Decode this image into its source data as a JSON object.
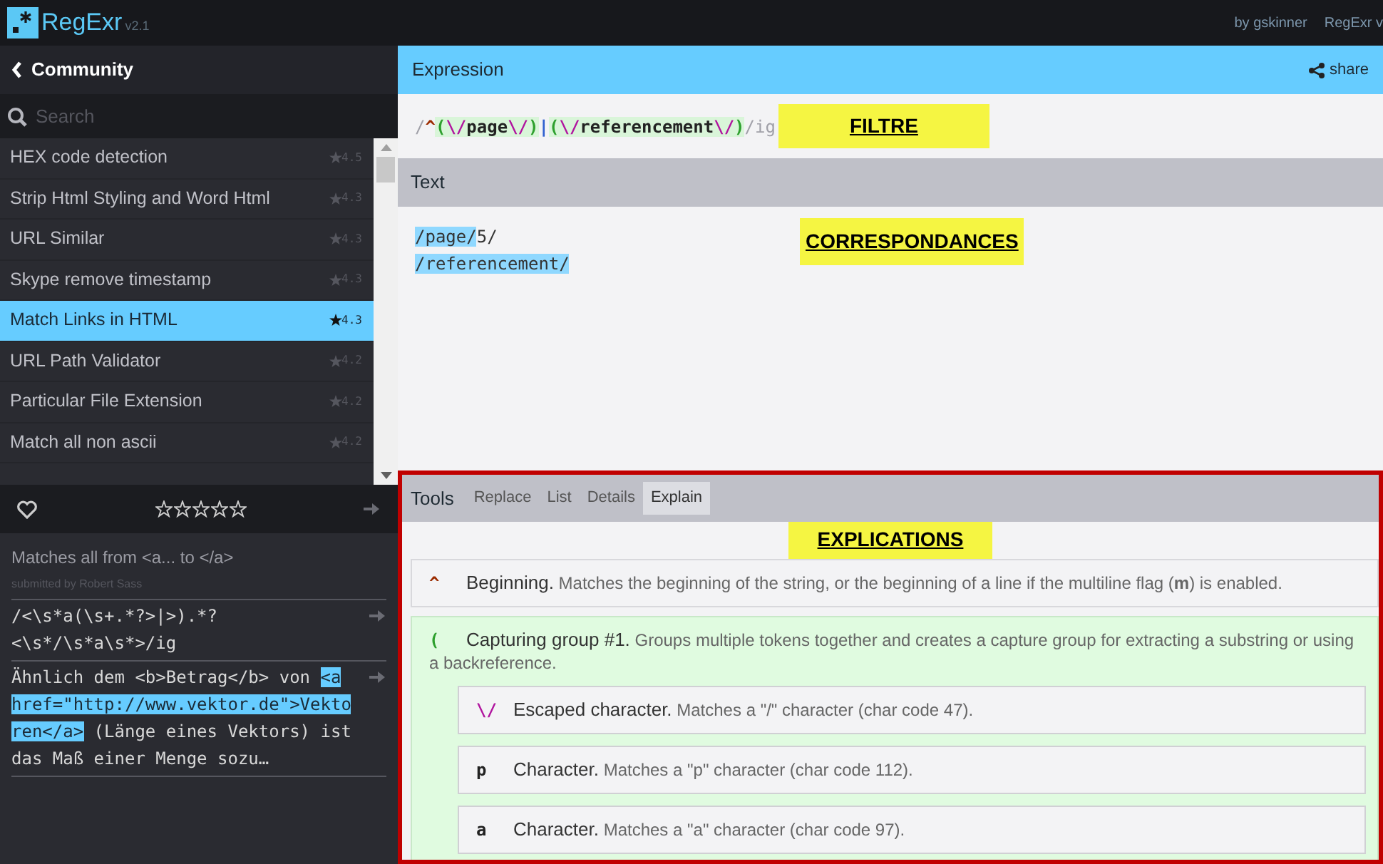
{
  "app": {
    "name": "RegExr",
    "version": "v2.1",
    "credits": [
      "by gskinner",
      "RegExr v"
    ]
  },
  "sidebar": {
    "title": "Community",
    "search": {
      "placeholder": "Search"
    },
    "items": [
      {
        "label": "HEX code detection",
        "rating": "4.5",
        "selected": false
      },
      {
        "label": "Strip Html Styling and Word Html",
        "rating": "4.3",
        "selected": false
      },
      {
        "label": "URL Similar",
        "rating": "4.3",
        "selected": false
      },
      {
        "label": "Skype remove timestamp",
        "rating": "4.3",
        "selected": false
      },
      {
        "label": "Match Links in HTML",
        "rating": "4.3",
        "selected": true
      },
      {
        "label": "URL Path Validator",
        "rating": "4.2",
        "selected": false
      },
      {
        "label": "Particular File Extension",
        "rating": "4.2",
        "selected": false
      },
      {
        "label": "Match all non ascii",
        "rating": "4.2",
        "selected": false
      }
    ],
    "details": {
      "stars": 0,
      "description": "Matches all from <a... to </a>",
      "submitted": "submitted by Robert Sass",
      "pattern": "/<\\s*a(\\s+.*?>|>).*?<\\s*/\\s*a\\s*>/ig",
      "sample": [
        {
          "text": "Ähnlich dem <b>Betrag</b> von ",
          "match": false
        },
        {
          "text": "<a href=\"http://www.vektor.de\">Vektoren</a>",
          "match": true
        },
        {
          "text": " (Länge eines Vektors) ist das Maß einer Menge sozu…",
          "match": false
        }
      ]
    }
  },
  "expression": {
    "title": "Expression",
    "share": "share",
    "tokens": [
      {
        "text": "/",
        "kind": "delimiter"
      },
      {
        "text": "^",
        "kind": "anchor"
      },
      {
        "text": "(",
        "kind": "group"
      },
      {
        "text": "\\/",
        "kind": "escape"
      },
      {
        "text": "page",
        "kind": "literal"
      },
      {
        "text": "\\/",
        "kind": "escape"
      },
      {
        "text": ")",
        "kind": "group"
      },
      {
        "text": "|",
        "kind": "alternation"
      },
      {
        "text": "(",
        "kind": "group"
      },
      {
        "text": "\\/",
        "kind": "escape"
      },
      {
        "text": "referencement",
        "kind": "literal"
      },
      {
        "text": "\\/",
        "kind": "escape"
      },
      {
        "text": ")",
        "kind": "group"
      },
      {
        "text": "/ig",
        "kind": "delimiter"
      }
    ],
    "note": "FILTRE"
  },
  "text": {
    "title": "Text",
    "note": "CORRESPONDANCES",
    "lines": [
      [
        {
          "text": "/page/",
          "match": true
        },
        {
          "text": "5/",
          "match": false
        }
      ],
      [
        {
          "text": "/referencement/",
          "match": true
        }
      ]
    ]
  },
  "tools": {
    "title": "Tools",
    "note": "EXPLICATIONS",
    "tabs": [
      {
        "label": "Replace",
        "selected": false
      },
      {
        "label": "List",
        "selected": false
      },
      {
        "label": "Details",
        "selected": false
      },
      {
        "label": "Explain",
        "selected": true
      }
    ],
    "explain": [
      {
        "token": "^",
        "kind": "anchor",
        "title": "Beginning.",
        "text": "Matches the beginning of the string, or the beginning of a line if the multiline flag (**m**) is enabled."
      },
      {
        "token": "(",
        "kind": "group",
        "title": "Capturing group #1.",
        "text": "Groups multiple tokens together and creates a capture group for extracting a substring or using a backreference.",
        "children": [
          {
            "token": "\\/",
            "kind": "escape",
            "title": "Escaped character.",
            "text": "Matches a \"/\" character (char code 47)."
          },
          {
            "token": "p",
            "kind": "literal",
            "title": "Character.",
            "text": "Matches a \"p\" character (char code 112)."
          },
          {
            "token": "a",
            "kind": "literal",
            "title": "Character.",
            "text": "Matches a \"a\" character (char code 97)."
          }
        ]
      }
    ]
  }
}
